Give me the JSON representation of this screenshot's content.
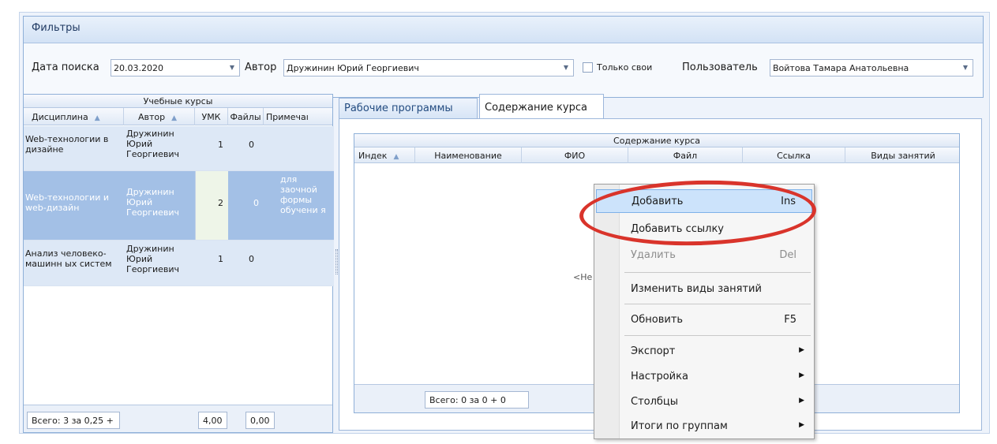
{
  "filters": {
    "title": "Фильтры",
    "date_label": "Дата поиска",
    "date_value": "20.03.2020",
    "author_label": "Автор",
    "author_value": "Дружинин Юрий Георгиевич",
    "only_mine_label": "Только свои",
    "only_mine_checked": false,
    "user_label": "Пользователь",
    "user_value": "Войтова Тамара Анатольевна"
  },
  "courses": {
    "title": "Учебные курсы",
    "columns": [
      "Дисциплина",
      "Автор",
      "УМК",
      "Файлы",
      "Примечаı"
    ],
    "rows": [
      {
        "discipline": "Web-технологии в дизайне",
        "author": "Дружинин Юрий Георгиевич",
        "umk": "1",
        "files": "0",
        "note": ""
      },
      {
        "discipline": "Web-технологии и web-дизайн",
        "author": "Дружинин Юрий Георгиевич",
        "umk": "2",
        "files": "0",
        "note": "для заочной формы обучени я"
      },
      {
        "discipline": "Анализ человеко-машинн ых систем",
        "author": "Дружинин Юрий Георгиевич",
        "umk": "1",
        "files": "0",
        "note": ""
      }
    ],
    "footer_total": "Всего: 3 за 0,25 +",
    "footer_umk": "4,00",
    "footer_files": "0,00"
  },
  "tabs": [
    {
      "label": "Рабочие программы",
      "active": false
    },
    {
      "label": "Содержание курса",
      "active": true
    }
  ],
  "content": {
    "title": "Содержание курса",
    "columns": [
      "Индек",
      "Наименование",
      "ФИО",
      "Файл",
      "Ссылка",
      "Виды занятий"
    ],
    "no_data": "<Не",
    "footer_total": "Всего: 0 за 0 + 0"
  },
  "context_menu": {
    "items": [
      {
        "label": "Добавить",
        "shortcut": "Ins",
        "highlighted": true
      },
      {
        "label": "Добавить ссылку",
        "shortcut": ""
      },
      {
        "label": "Удалить",
        "shortcut": "Del",
        "disabled": true
      },
      {
        "label": "Изменить виды занятий",
        "shortcut": ""
      },
      {
        "label": "Обновить",
        "shortcut": "F5"
      },
      {
        "label": "Экспорт",
        "submenu": true
      },
      {
        "label": "Настройка",
        "submenu": true
      },
      {
        "label": "Столбцы",
        "submenu": true
      },
      {
        "label": "Итоги по группам",
        "submenu": true
      }
    ]
  },
  "colors": {
    "selected_row": "#9fbde3",
    "selected_text": "#ffffff",
    "group_rows": "#dde8f6",
    "highlight_ellipse": "#d9342b",
    "menu_highlight": "#cce3fb"
  }
}
